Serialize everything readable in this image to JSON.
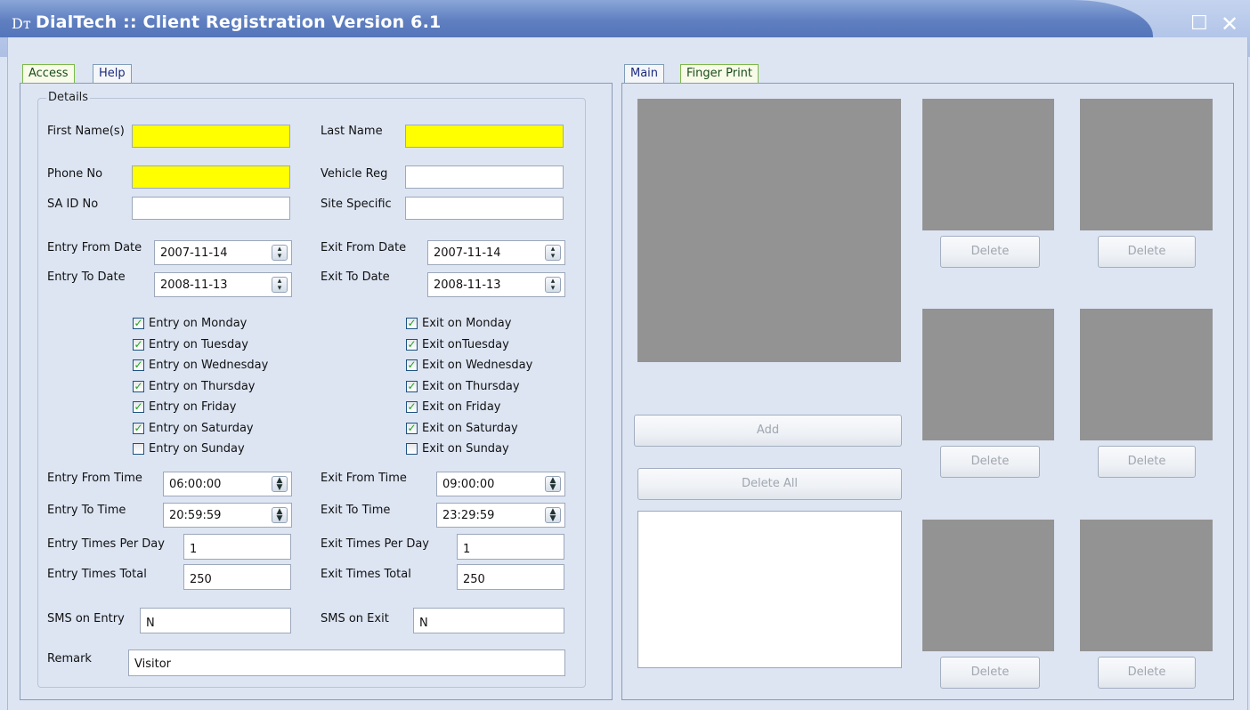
{
  "window": {
    "title": "DialTech :: Client Registration Version 6.1",
    "icon": "app-icon",
    "icon_glyph": "Dᴛ",
    "controls": {
      "minimize": "_",
      "maximize": "☐",
      "close": "✕"
    }
  },
  "left_panel": {
    "tabs": [
      {
        "label": "Access",
        "active": true
      },
      {
        "label": "Help",
        "active": false
      }
    ],
    "group_title": "Details",
    "fields": {
      "first_name": {
        "label": "First Name(s)",
        "value": ""
      },
      "last_name": {
        "label": "Last Name",
        "value": ""
      },
      "phone_no": {
        "label": "Phone No",
        "value": ""
      },
      "vehicle_reg": {
        "label": "Vehicle Reg",
        "value": ""
      },
      "sa_id_no": {
        "label": "SA ID No",
        "value": ""
      },
      "site_specific": {
        "label": "Site Specific",
        "value": ""
      },
      "entry_from_date": {
        "label": "Entry From Date",
        "value": "2007-11-14"
      },
      "entry_to_date": {
        "label": "Entry To Date",
        "value": "2008-11-13"
      },
      "exit_from_date": {
        "label": "Exit From Date",
        "value": "2007-11-14"
      },
      "exit_to_date": {
        "label": "Exit To Date",
        "value": "2008-11-13"
      },
      "entry_from_time": {
        "label": "Entry From Time",
        "value": "06:00:00"
      },
      "entry_to_time": {
        "label": "Entry To Time",
        "value": "20:59:59"
      },
      "exit_from_time": {
        "label": "Exit From Time",
        "value": "09:00:00"
      },
      "exit_to_time": {
        "label": "Exit To Time",
        "value": "23:29:59"
      },
      "entry_times_per_day": {
        "label": "Entry Times Per Day",
        "value": "1"
      },
      "exit_times_per_day": {
        "label": "Exit Times Per Day",
        "value": "1"
      },
      "entry_times_total": {
        "label": "Entry Times Total",
        "value": "250"
      },
      "exit_times_total": {
        "label": "Exit Times Total",
        "value": "250"
      },
      "sms_on_entry": {
        "label": "SMS on Entry",
        "value": "N"
      },
      "sms_on_exit": {
        "label": "SMS on Exit",
        "value": "N"
      },
      "remark": {
        "label": "Remark",
        "value": "Visitor"
      }
    },
    "entry_days": [
      {
        "label": "Entry on Monday",
        "checked": true
      },
      {
        "label": "Entry on Tuesday",
        "checked": true
      },
      {
        "label": "Entry on Wednesday",
        "checked": true
      },
      {
        "label": "Entry on Thursday",
        "checked": true
      },
      {
        "label": "Entry on Friday",
        "checked": true
      },
      {
        "label": "Entry on Saturday",
        "checked": true
      },
      {
        "label": "Entry on Sunday",
        "checked": false
      }
    ],
    "exit_days": [
      {
        "label": "Exit on Monday",
        "checked": true
      },
      {
        "label": "Exit onTuesday",
        "checked": true
      },
      {
        "label": "Exit on Wednesday",
        "checked": true
      },
      {
        "label": "Exit on Thursday",
        "checked": true
      },
      {
        "label": "Exit on Friday",
        "checked": true
      },
      {
        "label": "Exit on Saturday",
        "checked": true
      },
      {
        "label": "Exit on Sunday",
        "checked": false
      }
    ]
  },
  "right_panel": {
    "tabs": [
      {
        "label": "Main",
        "active": false
      },
      {
        "label": "Finger Print",
        "active": true
      }
    ],
    "add_label": "Add",
    "delete_all_label": "Delete All",
    "delete_label": "Delete"
  },
  "colors": {
    "required_field": "#ffff00",
    "photo_placeholder": "#939393",
    "title_bar": "#5f7fc0",
    "checkbox_tick": "#21a121"
  }
}
